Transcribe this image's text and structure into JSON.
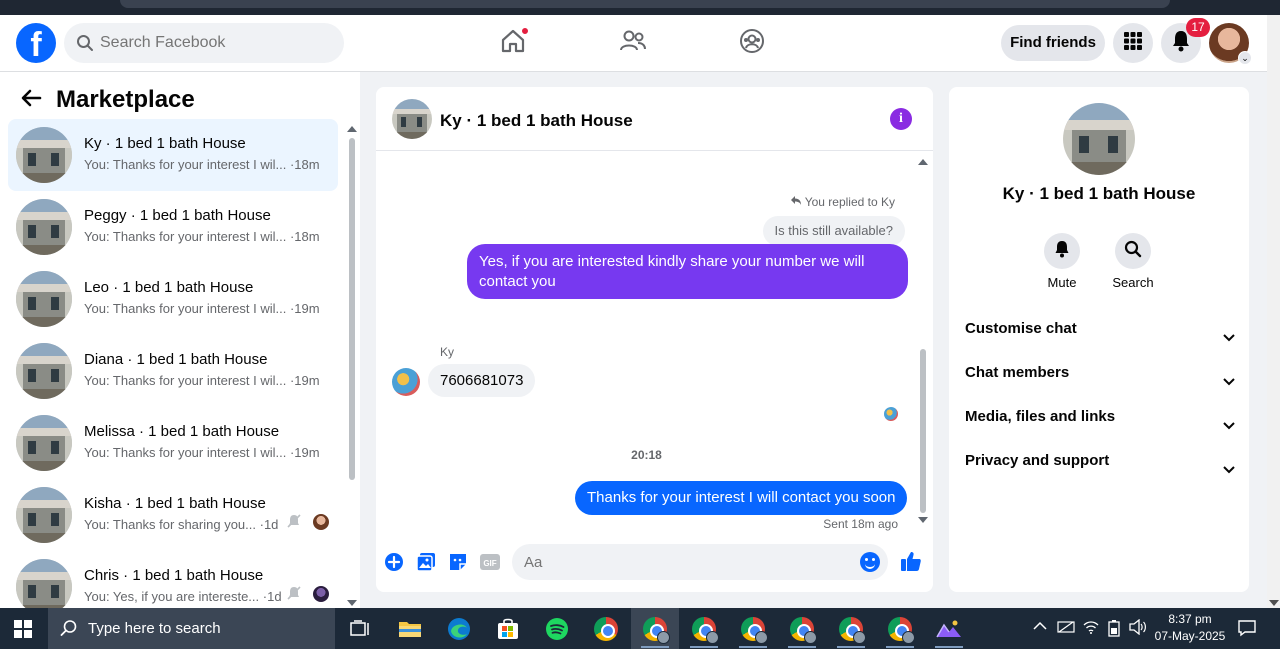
{
  "header": {
    "search_placeholder": "Search Facebook",
    "find_friends_label": "Find friends",
    "notification_count": "17"
  },
  "sidebar": {
    "title": "Marketplace",
    "conversations": [
      {
        "name": "Ky · 1 bed 1 bath House",
        "preview": "You: Thanks for your interest I wil...",
        "time": "·18m",
        "active": true
      },
      {
        "name": "Peggy · 1 bed 1 bath House",
        "preview": "You: Thanks for your interest I wil...",
        "time": "·18m"
      },
      {
        "name": "Leo · 1 bed 1 bath House",
        "preview": "You: Thanks for your interest I wil...",
        "time": "·19m"
      },
      {
        "name": "Diana · 1 bed 1 bath House",
        "preview": "You: Thanks for your interest I wil...",
        "time": "·19m"
      },
      {
        "name": "Melissa · 1 bed 1 bath House",
        "preview": "You: Thanks for your interest I wil...",
        "time": "·19m"
      },
      {
        "name": "Kisha · 1 bed 1 bath House",
        "preview": "You: Thanks for sharing you...",
        "time": "·1d",
        "muted": true
      },
      {
        "name": "Chris · 1 bed 1 bath House",
        "preview": "You: Yes, if you are intereste...",
        "time": "·1d",
        "muted": true
      }
    ]
  },
  "chat": {
    "title": "Ky · 1 bed 1 bath House",
    "replied_label": "You replied to Ky",
    "quoted_message": "Is this still available?",
    "outgoing_1": "Yes, if you are interested kindly share your number we will contact you",
    "sender_name": "Ky",
    "incoming_1": "7606681073",
    "timestamp": "20:18",
    "outgoing_2": "Thanks for your interest I will contact you soon",
    "sent_status": "Sent 18m ago",
    "input_placeholder": "Aa"
  },
  "details": {
    "title": "Ky · 1 bed 1 bath House",
    "actions": [
      {
        "label": "Mute",
        "icon": "bell-icon"
      },
      {
        "label": "Search",
        "icon": "search-icon"
      }
    ],
    "sections": [
      "Customise chat",
      "Chat members",
      "Media, files and links",
      "Privacy and support"
    ]
  },
  "taskbar": {
    "search_text": "Type here to search",
    "time": "8:37 pm",
    "date": "07-May-2025"
  },
  "colors": {
    "brand": "#0866ff",
    "outgoing_purple": "#7739f0",
    "outgoing_blue": "#0866ff",
    "info_accent": "#8a2be2"
  }
}
